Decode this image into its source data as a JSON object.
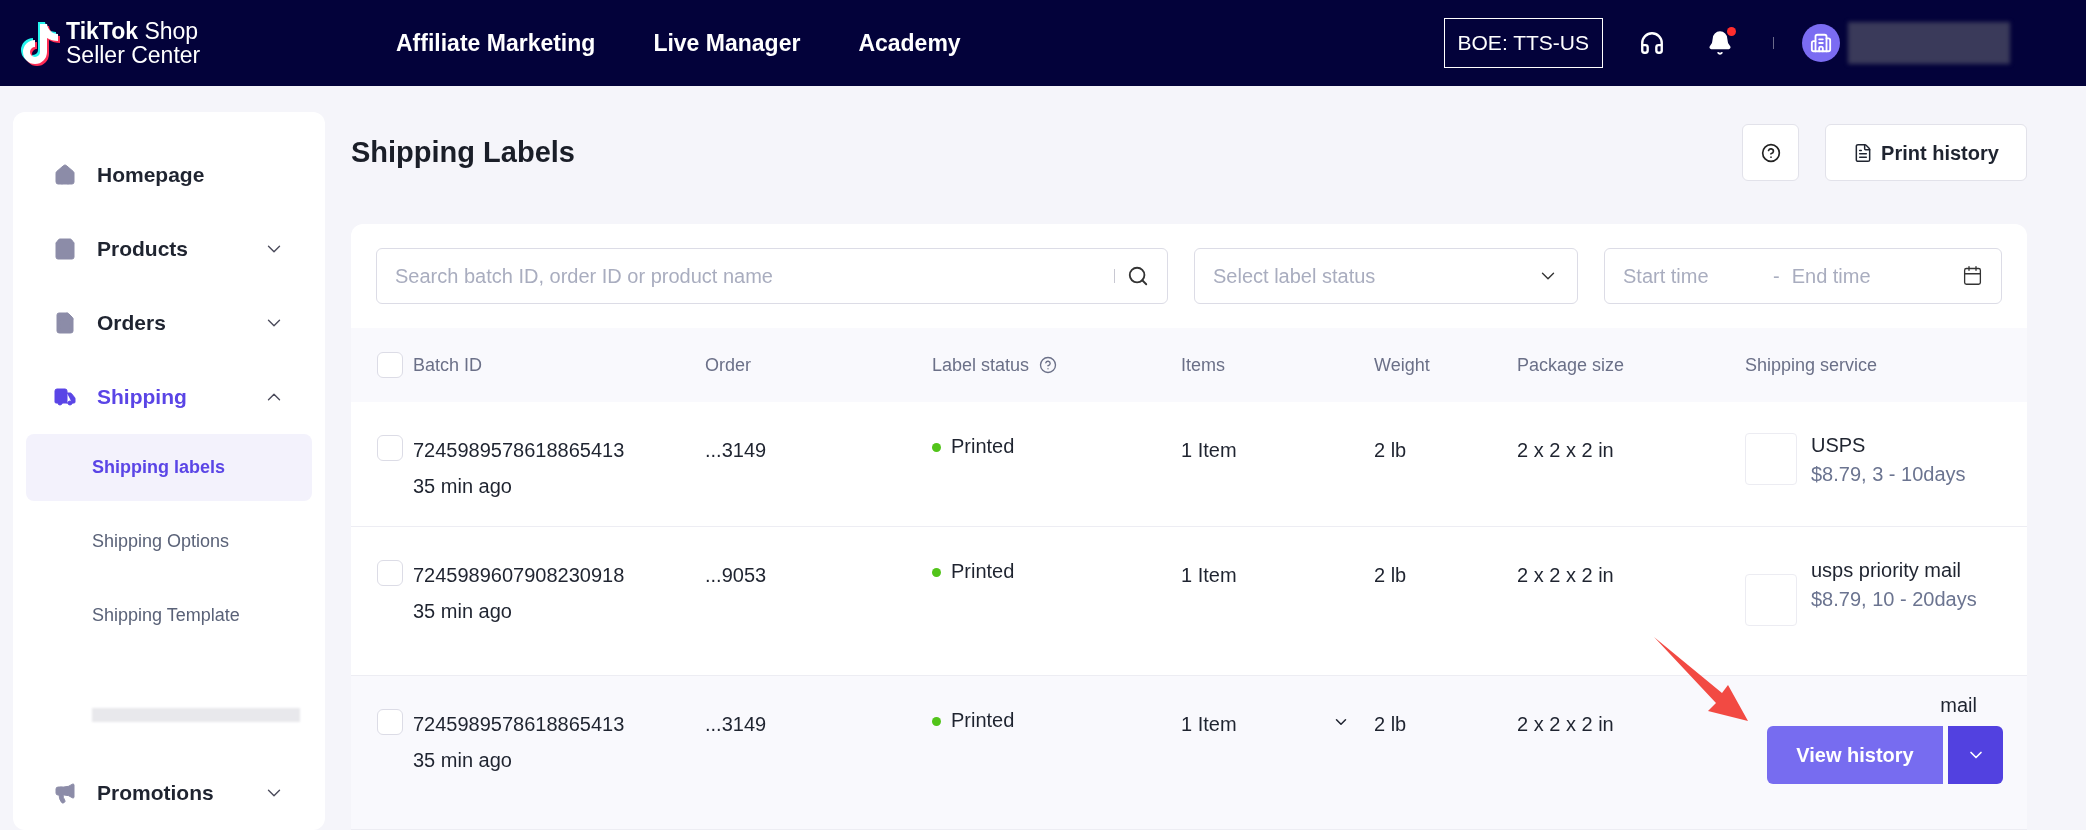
{
  "header": {
    "logo_line1": "**TikTok** Shop",
    "logo_line2": "Seller Center",
    "nav": [
      {
        "label": "Affiliate Marketing"
      },
      {
        "label": "Live Manager"
      },
      {
        "label": "Academy"
      }
    ],
    "environment": "BOE: TTS-US",
    "notification_dot": true
  },
  "sidebar": {
    "items": [
      {
        "label": "Homepage",
        "selected": false
      },
      {
        "label": "Products",
        "selected": false,
        "expanded": false
      },
      {
        "label": "Orders",
        "selected": false,
        "expanded": false
      },
      {
        "label": "Shipping",
        "selected": true,
        "expanded": true,
        "children": [
          {
            "label": "Shipping labels",
            "selected": true
          },
          {
            "label": "Shipping Options",
            "selected": false
          },
          {
            "label": "Shipping Template",
            "selected": false
          }
        ]
      },
      {
        "label": "Promotions",
        "selected": false,
        "expanded": false
      }
    ]
  },
  "page": {
    "title": "Shipping Labels",
    "print_history": "Print history"
  },
  "filters": {
    "search_placeholder": "Search batch ID, order ID or product name",
    "status_placeholder": "Select label status",
    "start_placeholder": "Start time",
    "separator": "-",
    "end_placeholder": "End time"
  },
  "table": {
    "select_all_checked": false,
    "columns": [
      "Batch ID",
      "Order",
      "Label status",
      "Items",
      "Weight",
      "Package size",
      "Shipping service"
    ],
    "rows": [
      {
        "checked": false,
        "highlighted": false,
        "batch_id": "7245989578618865413",
        "time": "35 min ago",
        "order": "...3149",
        "status": "Printed",
        "color": "#52c41a",
        "items": "1 Item",
        "expandable": false,
        "weight": "2 lb",
        "package": "2 x 2 x 2 in",
        "service": "USPS",
        "service_detail": "$8.79, 3 - 10days"
      },
      {
        "checked": false,
        "highlighted": false,
        "batch_id": "7245989607908230918",
        "time": "35 min ago",
        "order": "...9053",
        "status": "Printed",
        "color": "#52c41a",
        "items": "1 Item",
        "expandable": false,
        "weight": "2 lb",
        "package": "2 x 2 x 2 in",
        "service": "usps priority mail",
        "service_detail": "$8.79, 10 - 20days"
      },
      {
        "checked": false,
        "highlighted": true,
        "batch_id": "7245989578618865413",
        "time": "35 min ago",
        "order": "...3149",
        "status": "Printed",
        "color": "#52c41a",
        "items": "1 Item",
        "expandable": true,
        "weight": "2 lb",
        "package": "2 x 2 x 2 in",
        "service": "mail",
        "action": "View history"
      }
    ]
  }
}
